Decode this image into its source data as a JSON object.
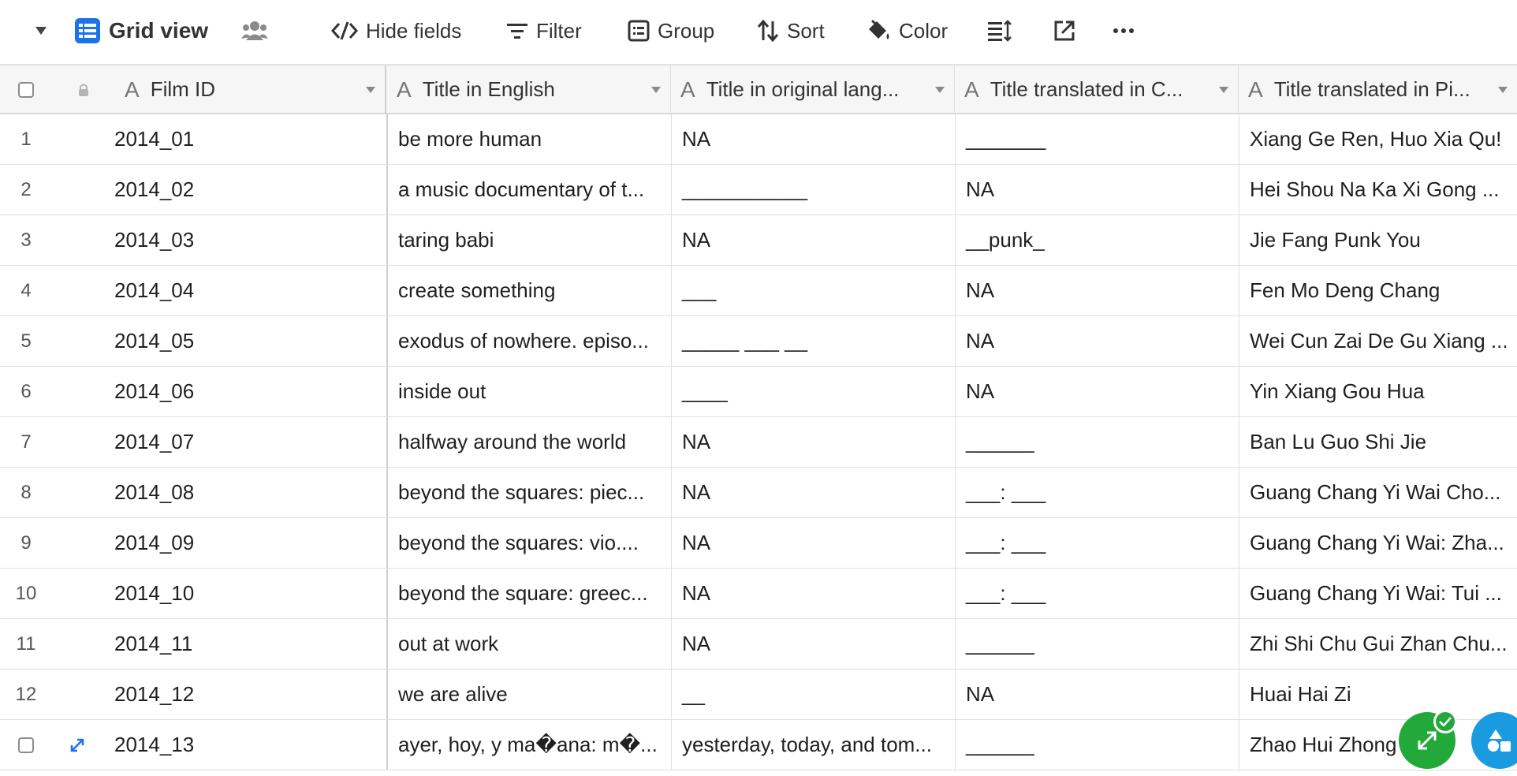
{
  "toolbar": {
    "view_name": "Grid view",
    "hide_fields": "Hide fields",
    "filter": "Filter",
    "group": "Group",
    "sort": "Sort",
    "color": "Color",
    "more": "···"
  },
  "columns": {
    "film_id": "Film ID",
    "title_en": "Title in English",
    "title_orig": "Title in original lang...",
    "title_cn": "Title translated in C...",
    "title_py": "Title translated in Pi..."
  },
  "rows": [
    {
      "num": "1",
      "id": "2014_01",
      "en": "be more human",
      "orig": "NA",
      "cn": "_______",
      "py": "Xiang Ge Ren, Huo Xia Qu!"
    },
    {
      "num": "2",
      "id": "2014_02",
      "en": "a music documentary of t...",
      "orig": "___________",
      "cn": "NA",
      "py": "Hei Shou Na Ka Xi Gong ..."
    },
    {
      "num": "3",
      "id": "2014_03",
      "en": "taring babi",
      "orig": "NA",
      "cn": "__punk_",
      "py": "Jie Fang Punk You"
    },
    {
      "num": "4",
      "id": "2014_04",
      "en": "create something",
      "orig": "___",
      "cn": "NA",
      "py": "Fen Mo Deng Chang"
    },
    {
      "num": "5",
      "id": "2014_05",
      "en": "exodus of nowhere. episo...",
      "orig": "_____ ___ __",
      "cn": "NA",
      "py": "Wei Cun Zai De Gu Xiang ..."
    },
    {
      "num": "6",
      "id": "2014_06",
      "en": "inside out",
      "orig": "____",
      "cn": "NA",
      "py": "Yin Xiang Gou Hua"
    },
    {
      "num": "7",
      "id": "2014_07",
      "en": "halfway around the world",
      "orig": "NA",
      "cn": "______",
      "py": "Ban Lu Guo Shi Jie"
    },
    {
      "num": "8",
      "id": "2014_08",
      "en": "beyond the squares: piec...",
      "orig": "NA",
      "cn": "___: ___",
      "py": "Guang Chang Yi Wai Cho..."
    },
    {
      "num": "9",
      "id": "2014_09",
      "en": "beyond the squares: vio....",
      "orig": "NA",
      "cn": "___: ___",
      "py": "Guang Chang Yi Wai: Zha..."
    },
    {
      "num": "10",
      "id": "2014_10",
      "en": "beyond the square: greec...",
      "orig": "NA",
      "cn": "___: ___",
      "py": "Guang Chang Yi Wai: Tui ..."
    },
    {
      "num": "11",
      "id": "2014_11",
      "en": "out at work",
      "orig": "NA",
      "cn": "______",
      "py": "Zhi Shi Chu Gui Zhan Chu..."
    },
    {
      "num": "12",
      "id": "2014_12",
      "en": "we are alive",
      "orig": "__",
      "cn": "NA",
      "py": "Huai Hai Zi"
    },
    {
      "num": "",
      "id": "2014_13",
      "en": "ayer, hoy, y ma�ana: m�...",
      "orig": "yesterday, today, and tom...",
      "cn": "______",
      "py": "Zhao Hui Zhong   ng"
    }
  ],
  "colors": {
    "accent_blue": "#1a73e8",
    "fab_green": "#22a93a",
    "fab_blue": "#1a9bdf"
  }
}
